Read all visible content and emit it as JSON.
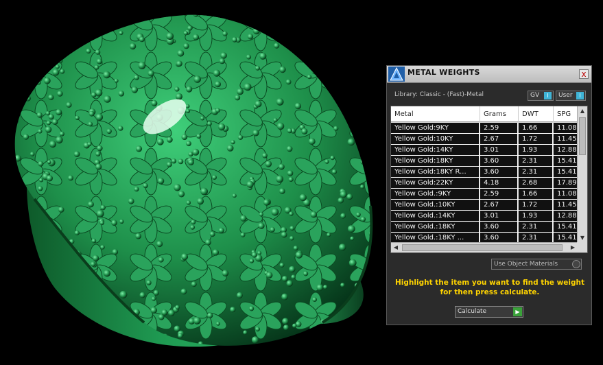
{
  "panel": {
    "title": "METAL WEIGHTS",
    "close_label": "x",
    "library_label": "Library: Classic - (Fast)-Metal",
    "toggle_gv": "GV",
    "toggle_user": "User",
    "toggle_knob": "I",
    "use_object_materials": "Use Object Materials",
    "instruction": "Highlight the item you want to find the weight for then press calculate.",
    "calculate_label": "Calculate",
    "calculate_arrow": "▶"
  },
  "table": {
    "columns": [
      "Metal",
      "Grams",
      "DWT",
      "SPG"
    ],
    "rows": [
      {
        "metal": "Yellow Gold:9KY",
        "grams": "2.59",
        "dwt": "1.66",
        "spg": "11.08"
      },
      {
        "metal": "Yellow Gold:10KY",
        "grams": "2.67",
        "dwt": "1.72",
        "spg": "11.45"
      },
      {
        "metal": "Yellow Gold:14KY",
        "grams": "3.01",
        "dwt": "1.93",
        "spg": "12.88"
      },
      {
        "metal": "Yellow Gold:18KY",
        "grams": "3.60",
        "dwt": "2.31",
        "spg": "15.41"
      },
      {
        "metal": "Yellow Gold:18KY R...",
        "grams": "3.60",
        "dwt": "2.31",
        "spg": "15.41"
      },
      {
        "metal": "Yellow Gold:22KY",
        "grams": "4.18",
        "dwt": "2.68",
        "spg": "17.89"
      },
      {
        "metal": "Yellow Gold.:9KY",
        "grams": "2.59",
        "dwt": "1.66",
        "spg": "11.08"
      },
      {
        "metal": "Yellow Gold.:10KY",
        "grams": "2.67",
        "dwt": "1.72",
        "spg": "11.45"
      },
      {
        "metal": "Yellow Gold.:14KY",
        "grams": "3.01",
        "dwt": "1.93",
        "spg": "12.88"
      },
      {
        "metal": "Yellow Gold.:18KY",
        "grams": "3.60",
        "dwt": "2.31",
        "spg": "15.41"
      },
      {
        "metal": "Yellow Gold.:18KY ...",
        "grams": "3.60",
        "dwt": "2.31",
        "spg": "15.41"
      }
    ]
  },
  "colors": {
    "ring": "#1e8f4a",
    "ring_dark": "#0c4a22",
    "instruction_text": "#ffd400",
    "knob_blue": "#3fb4d6",
    "calc_green": "#3aa23a"
  },
  "icons": {
    "logo": "matrix-logo-icon",
    "close": "close-icon",
    "scroll_up": "chevron-up-icon",
    "scroll_down": "chevron-down-icon",
    "scroll_left": "chevron-left-icon",
    "scroll_right": "chevron-right-icon"
  }
}
